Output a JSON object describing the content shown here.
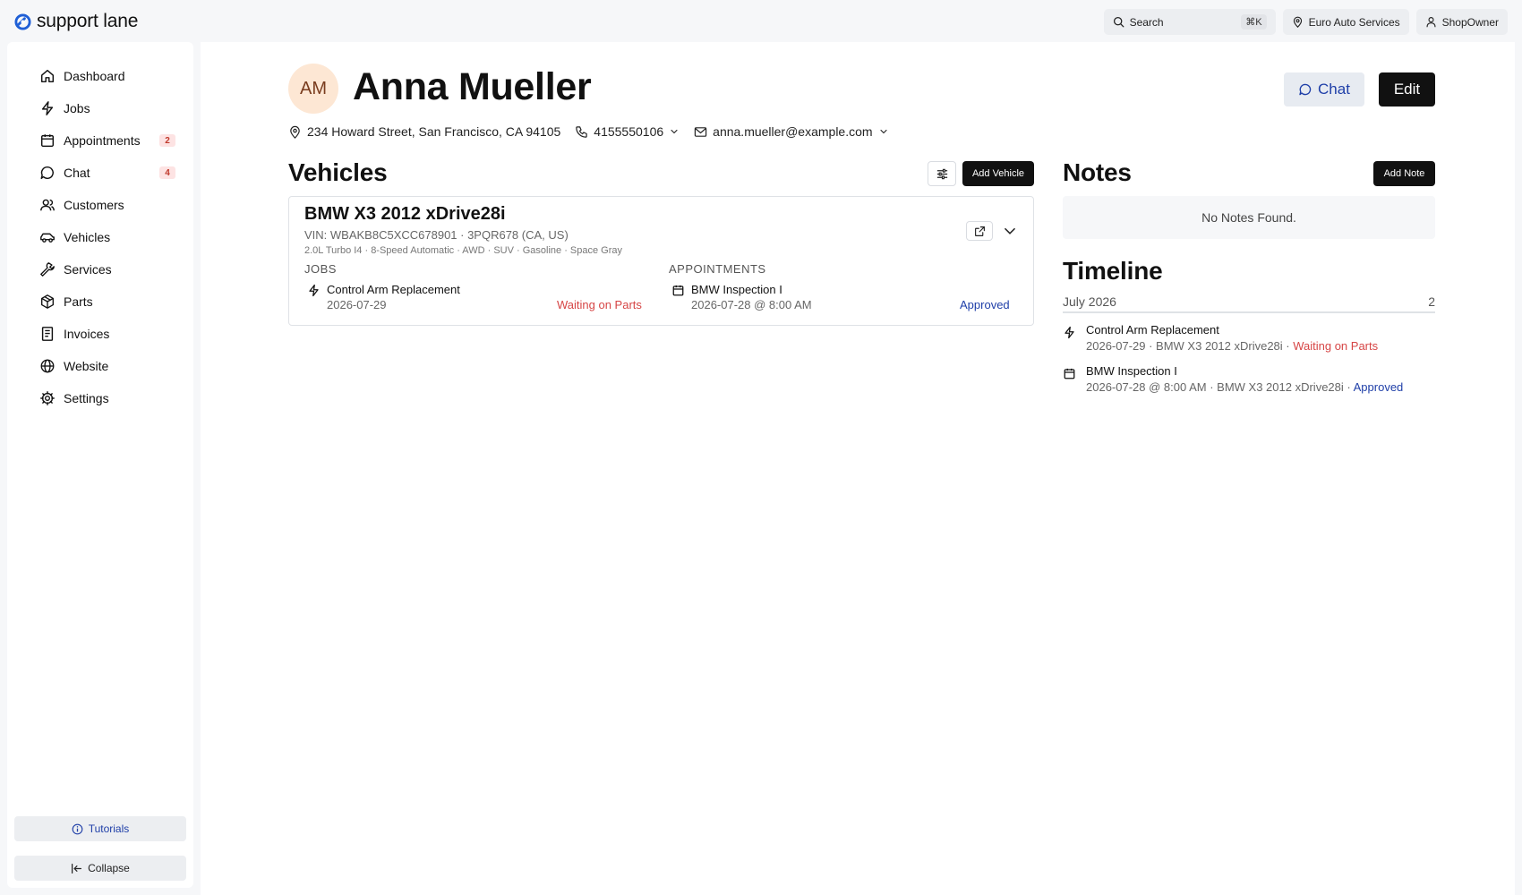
{
  "app": {
    "brand_name": "support lane"
  },
  "topbar": {
    "search_label": "Search",
    "search_shortcut": "⌘K",
    "shop_name": "Euro Auto Services",
    "user_name": "ShopOwner"
  },
  "sidebar": {
    "items": [
      {
        "label": "Dashboard",
        "icon": "home-icon"
      },
      {
        "label": "Jobs",
        "icon": "bolt-icon"
      },
      {
        "label": "Appointments",
        "icon": "calendar-icon",
        "badge": "2"
      },
      {
        "label": "Chat",
        "icon": "chat-bubble-icon",
        "badge": "4"
      },
      {
        "label": "Customers",
        "icon": "users-icon"
      },
      {
        "label": "Vehicles",
        "icon": "car-icon"
      },
      {
        "label": "Services",
        "icon": "wrench-icon"
      },
      {
        "label": "Parts",
        "icon": "box-icon"
      },
      {
        "label": "Invoices",
        "icon": "receipt-icon"
      },
      {
        "label": "Website",
        "icon": "globe-icon"
      },
      {
        "label": "Settings",
        "icon": "gear-icon"
      }
    ],
    "tutorials_label": "Tutorials",
    "collapse_label": "Collapse"
  },
  "customer": {
    "initials": "AM",
    "name": "Anna Mueller",
    "address": "234 Howard Street, San Francisco, CA 94105",
    "phone": "4155550106",
    "email": "anna.mueller@example.com",
    "chat_label": "Chat",
    "edit_label": "Edit"
  },
  "vehicles": {
    "title": "Vehicles",
    "add_label": "Add Vehicle",
    "list": [
      {
        "title": "BMW X3 2012 xDrive28i",
        "vin_line": "VIN: WBAKB8C5XCC678901 · 3PQR678 (CA, US)",
        "specs": "2.0L Turbo I4 · 8-Speed Automatic · AWD · SUV · Gasoline · Space Gray",
        "jobs_heading": "JOBS",
        "appointments_heading": "APPOINTMENTS",
        "job": {
          "title": "Control Arm Replacement",
          "date": "2026-07-29",
          "status": "Waiting on Parts"
        },
        "appointment": {
          "title": "BMW Inspection I",
          "date": "2026-07-28 @ 8:00 AM",
          "status": "Approved"
        }
      }
    ]
  },
  "notes": {
    "title": "Notes",
    "add_label": "Add Note",
    "empty_text": "No Notes Found."
  },
  "timeline": {
    "title": "Timeline",
    "month": "July 2026",
    "count": "2",
    "items": [
      {
        "title": "Control Arm Replacement",
        "detail": "2026-07-29 · BMW X3 2012 xDrive28i · ",
        "status": "Waiting on Parts",
        "icon": "bolt-icon"
      },
      {
        "title": "BMW Inspection I",
        "detail": "2026-07-28 @ 8:00 AM · BMW X3 2012 xDrive28i · ",
        "status": "Approved",
        "icon": "calendar-icon"
      }
    ]
  },
  "colors": {
    "accent_blue": "#1f3fa8",
    "status_red": "#d64545",
    "badge_bg": "#fde3e3",
    "avatar_bg": "#fde7d4"
  }
}
